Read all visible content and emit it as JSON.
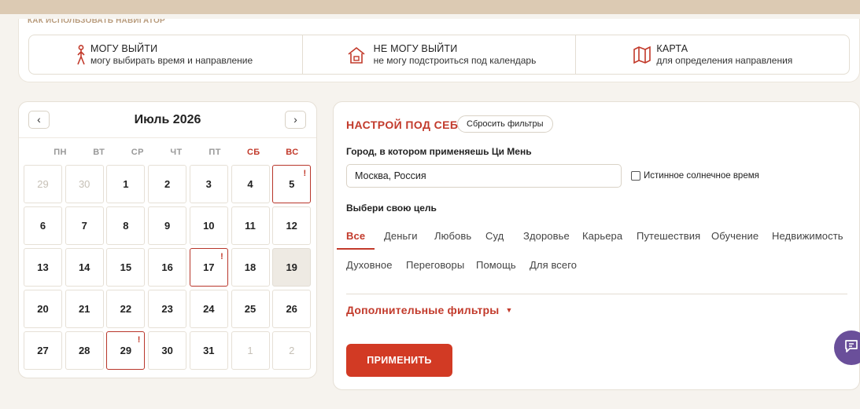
{
  "navigator": {
    "heading": "Как использовать навигатор",
    "options": [
      {
        "title": "МОГУ ВЫЙТИ",
        "subtitle": "могу выбирать время и направление",
        "icon": "walking-person-icon"
      },
      {
        "title": "НЕ МОГУ ВЫЙТИ",
        "subtitle": "не могу подстроиться под календарь",
        "icon": "house-icon"
      },
      {
        "title": "КАРТА",
        "subtitle": "для определения направления",
        "icon": "map-icon"
      }
    ]
  },
  "calendar": {
    "title": "Июль 2026",
    "prev": "‹",
    "next": "›",
    "weekdays": [
      "ПН",
      "ВТ",
      "СР",
      "ЧТ",
      "ПТ",
      "СБ",
      "ВС"
    ],
    "weeks": [
      [
        {
          "d": "29",
          "muted": true
        },
        {
          "d": "30",
          "muted": true
        },
        {
          "d": "1"
        },
        {
          "d": "2"
        },
        {
          "d": "3"
        },
        {
          "d": "4"
        },
        {
          "d": "5",
          "marked": true
        }
      ],
      [
        {
          "d": "6"
        },
        {
          "d": "7"
        },
        {
          "d": "8"
        },
        {
          "d": "9"
        },
        {
          "d": "10"
        },
        {
          "d": "11"
        },
        {
          "d": "12"
        }
      ],
      [
        {
          "d": "13"
        },
        {
          "d": "14"
        },
        {
          "d": "15"
        },
        {
          "d": "16"
        },
        {
          "d": "17",
          "marked": true
        },
        {
          "d": "18"
        },
        {
          "d": "19",
          "today": true
        }
      ],
      [
        {
          "d": "20"
        },
        {
          "d": "21"
        },
        {
          "d": "22"
        },
        {
          "d": "23"
        },
        {
          "d": "24"
        },
        {
          "d": "25"
        },
        {
          "d": "26"
        }
      ],
      [
        {
          "d": "27"
        },
        {
          "d": "28"
        },
        {
          "d": "29",
          "marked": true
        },
        {
          "d": "30"
        },
        {
          "d": "31"
        },
        {
          "d": "1",
          "muted": true
        },
        {
          "d": "2",
          "muted": true
        }
      ]
    ],
    "mark_symbol": "!"
  },
  "filters": {
    "title": "НАСТРОЙ ПОД СЕБЯ",
    "reset_label": "Сбросить фильтры",
    "city_label": "Город, в котором применяешь Ци Мень",
    "city_value": "Москва, Россия",
    "solar_time_label": "Истинное солнечное время",
    "solar_time_checked": false,
    "goal_label": "Выбери свою цель",
    "goals_row1": [
      "Все",
      "Деньги",
      "Любовь",
      "Суд",
      "Здоровье",
      "Карьера",
      "Путешествия",
      "Обучение",
      "Недвижимость"
    ],
    "goals_row2": [
      "Духовное",
      "Переговоры",
      "Помощь",
      "Для всего"
    ],
    "active_goal": "Все",
    "extra_filters_label": "Дополнительные фильтры",
    "extra_filters_arrow": "▼",
    "apply_label": "ПРИМЕНИТЬ"
  },
  "colors": {
    "accent": "#c23a2b",
    "apply": "#d23a24",
    "chat": "#6a4f9a"
  }
}
